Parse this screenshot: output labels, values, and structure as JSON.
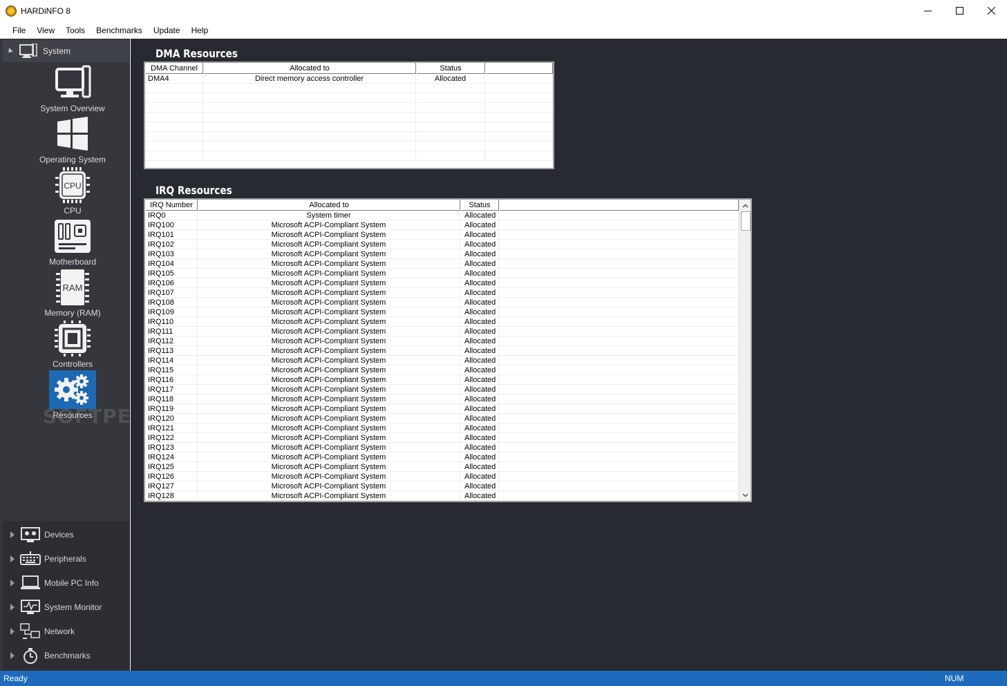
{
  "window": {
    "title": "HARDiNFO 8"
  },
  "menu": [
    "File",
    "View",
    "Tools",
    "Benchmarks",
    "Update",
    "Help"
  ],
  "sidebar": {
    "section": "System",
    "items": [
      {
        "label": "System Overview",
        "icon": "monitor-icon"
      },
      {
        "label": "Operating System",
        "icon": "windows-logo-icon"
      },
      {
        "label": "CPU",
        "icon": "cpu-chip-icon",
        "chip_text": "CPU"
      },
      {
        "label": "Motherboard",
        "icon": "motherboard-icon"
      },
      {
        "label": "Memory (RAM)",
        "icon": "ram-chip-icon",
        "chip_text": "RAM"
      },
      {
        "label": "Controllers",
        "icon": "controller-chip-icon"
      },
      {
        "label": "Resources",
        "icon": "gears-icon",
        "active": true
      }
    ],
    "lower": [
      {
        "label": "Devices",
        "icon": "devices-icon"
      },
      {
        "label": "Peripherals",
        "icon": "keyboard-icon"
      },
      {
        "label": "Mobile PC Info",
        "icon": "laptop-icon"
      },
      {
        "label": "System Monitor",
        "icon": "pulse-monitor-icon"
      },
      {
        "label": "Network",
        "icon": "network-icon"
      },
      {
        "label": "Benchmarks",
        "icon": "stopwatch-icon"
      }
    ]
  },
  "watermark": "SOFTPEDIA",
  "dma": {
    "title": "DMA Resources",
    "columns": [
      "DMA Channel",
      "Allocated to",
      "Status",
      ""
    ],
    "rows": [
      [
        "DMA4",
        "Direct memory access controller",
        "Allocated",
        ""
      ]
    ]
  },
  "irq": {
    "title": "IRQ Resources",
    "columns": [
      "IRQ Number",
      "Allocated to",
      "Status",
      ""
    ],
    "rows": [
      [
        "IRQ0",
        "System timer",
        "Allocated"
      ],
      [
        "IRQ100",
        "Microsoft ACPI-Compliant System",
        "Allocated"
      ],
      [
        "IRQ101",
        "Microsoft ACPI-Compliant System",
        "Allocated"
      ],
      [
        "IRQ102",
        "Microsoft ACPI-Compliant System",
        "Allocated"
      ],
      [
        "IRQ103",
        "Microsoft ACPI-Compliant System",
        "Allocated"
      ],
      [
        "IRQ104",
        "Microsoft ACPI-Compliant System",
        "Allocated"
      ],
      [
        "IRQ105",
        "Microsoft ACPI-Compliant System",
        "Allocated"
      ],
      [
        "IRQ106",
        "Microsoft ACPI-Compliant System",
        "Allocated"
      ],
      [
        "IRQ107",
        "Microsoft ACPI-Compliant System",
        "Allocated"
      ],
      [
        "IRQ108",
        "Microsoft ACPI-Compliant System",
        "Allocated"
      ],
      [
        "IRQ109",
        "Microsoft ACPI-Compliant System",
        "Allocated"
      ],
      [
        "IRQ110",
        "Microsoft ACPI-Compliant System",
        "Allocated"
      ],
      [
        "IRQ111",
        "Microsoft ACPI-Compliant System",
        "Allocated"
      ],
      [
        "IRQ112",
        "Microsoft ACPI-Compliant System",
        "Allocated"
      ],
      [
        "IRQ113",
        "Microsoft ACPI-Compliant System",
        "Allocated"
      ],
      [
        "IRQ114",
        "Microsoft ACPI-Compliant System",
        "Allocated"
      ],
      [
        "IRQ115",
        "Microsoft ACPI-Compliant System",
        "Allocated"
      ],
      [
        "IRQ116",
        "Microsoft ACPI-Compliant System",
        "Allocated"
      ],
      [
        "IRQ117",
        "Microsoft ACPI-Compliant System",
        "Allocated"
      ],
      [
        "IRQ118",
        "Microsoft ACPI-Compliant System",
        "Allocated"
      ],
      [
        "IRQ119",
        "Microsoft ACPI-Compliant System",
        "Allocated"
      ],
      [
        "IRQ120",
        "Microsoft ACPI-Compliant System",
        "Allocated"
      ],
      [
        "IRQ121",
        "Microsoft ACPI-Compliant System",
        "Allocated"
      ],
      [
        "IRQ122",
        "Microsoft ACPI-Compliant System",
        "Allocated"
      ],
      [
        "IRQ123",
        "Microsoft ACPI-Compliant System",
        "Allocated"
      ],
      [
        "IRQ124",
        "Microsoft ACPI-Compliant System",
        "Allocated"
      ],
      [
        "IRQ125",
        "Microsoft ACPI-Compliant System",
        "Allocated"
      ],
      [
        "IRQ126",
        "Microsoft ACPI-Compliant System",
        "Allocated"
      ],
      [
        "IRQ127",
        "Microsoft ACPI-Compliant System",
        "Allocated"
      ],
      [
        "IRQ128",
        "Microsoft ACPI-Compliant System",
        "Allocated"
      ]
    ]
  },
  "status": {
    "left": "Ready",
    "right": "NUM"
  },
  "colors": {
    "sidebar": "#35373d",
    "content": "#272a31",
    "accent": "#1e6bbd"
  }
}
